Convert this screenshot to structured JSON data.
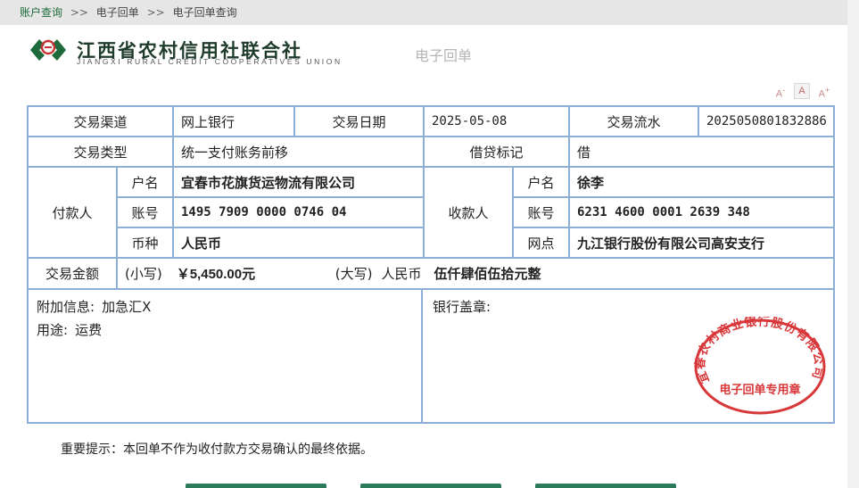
{
  "breadcrumb": {
    "root": "账户查询",
    "sep": ">>",
    "level2": "电子回单",
    "level3": "电子回单查询"
  },
  "header": {
    "bank_name_cn": "江西省农村信用社联合社",
    "bank_name_en": "JIANGXI RURAL CREDIT COOPERATIVES UNION",
    "doc_title": "电子回单"
  },
  "font_controls": {
    "decrease": "A",
    "normal": "A",
    "increase": "A"
  },
  "receipt": {
    "channel_label": "交易渠道",
    "channel_value": "网上银行",
    "date_label": "交易日期",
    "date_value": "2025-05-08",
    "serial_label": "交易流水",
    "serial_value": "2025050801832886",
    "type_label": "交易类型",
    "type_value": "统一支付账务前移",
    "dc_label": "借贷标记",
    "dc_value": "借",
    "payer_label": "付款人",
    "payee_label": "收款人",
    "name_label": "户名",
    "account_label": "账号",
    "currency_label": "币种",
    "branch_label": "网点",
    "payer_name": "宜春市花旗货运物流有限公司",
    "payer_account": "1495 7909 0000 0746 04",
    "payer_currency": "人民币",
    "payee_name": "徐李",
    "payee_account": "6231 4600 0001 2639 348",
    "payee_branch": "九江银行股份有限公司高安支行",
    "amount_label": "交易金额",
    "small_label": "(小写)",
    "small_value": "￥5,450.00元",
    "big_label": "(大写)",
    "big_currency": "人民币",
    "big_value": "伍仟肆佰伍拾元整",
    "extra_label": "附加信息:",
    "extra_value": "加急汇X",
    "purpose_label": "用途:",
    "purpose_value": "运费",
    "seal_label": "银行盖章:"
  },
  "stamp": {
    "arc_text": "宜春农村商业银行股份有限公司",
    "center_text": "电子回单专用章",
    "color": "#d8383a"
  },
  "notice": "重要提示：本回单不作为收付款方交易确认的最终依据。",
  "colors": {
    "accent": "#1d6b3a",
    "table_border": "#8fb0d6",
    "button": "#2d7a5a"
  }
}
